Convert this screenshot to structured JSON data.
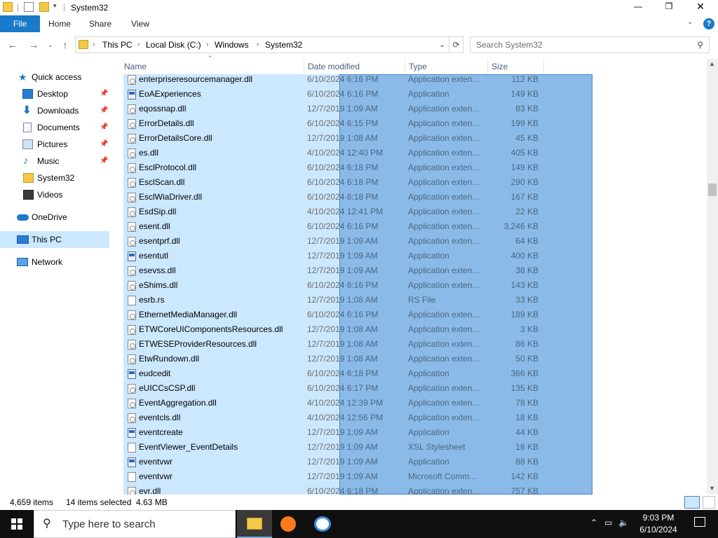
{
  "window": {
    "title": "System32"
  },
  "window_controls": {
    "minimize": "—",
    "maximize": "❐",
    "close": "✕"
  },
  "ribbon": {
    "tabs": [
      "File",
      "Home",
      "Share",
      "View"
    ],
    "help": "?"
  },
  "address": {
    "crumbs": [
      "This PC",
      "Local Disk (C:)",
      "Windows",
      "System32"
    ]
  },
  "search": {
    "placeholder": "Search System32"
  },
  "sidebar": {
    "items": [
      {
        "label": "Quick access",
        "icon": "star-icon"
      },
      {
        "label": "Desktop",
        "icon": "desktop-icon",
        "pinned": true
      },
      {
        "label": "Downloads",
        "icon": "download-icon",
        "pinned": true
      },
      {
        "label": "Documents",
        "icon": "documents-icon",
        "pinned": true
      },
      {
        "label": "Pictures",
        "icon": "pictures-icon",
        "pinned": true
      },
      {
        "label": "Music",
        "icon": "music-icon",
        "pinned": true
      },
      {
        "label": "System32",
        "icon": "folder-icon"
      },
      {
        "label": "Videos",
        "icon": "videos-icon"
      },
      {
        "label": "OneDrive",
        "icon": "cloud-icon"
      },
      {
        "label": "This PC",
        "icon": "computer-icon",
        "selected": true
      },
      {
        "label": "Network",
        "icon": "network-icon"
      }
    ]
  },
  "columns": [
    "Name",
    "Date modified",
    "Type",
    "Size"
  ],
  "files": [
    {
      "name": "enterpriseresourcemanager.dll",
      "date": "6/10/2024 6:16 PM",
      "type": "Application exten...",
      "size": "112 KB",
      "kind": "dll"
    },
    {
      "name": "EoAExperiences",
      "date": "6/10/2024 6:16 PM",
      "type": "Application",
      "size": "149 KB",
      "kind": "app"
    },
    {
      "name": "eqossnap.dll",
      "date": "12/7/2019 1:09 AM",
      "type": "Application exten...",
      "size": "83 KB",
      "kind": "dll"
    },
    {
      "name": "ErrorDetails.dll",
      "date": "6/10/2024 6:15 PM",
      "type": "Application exten...",
      "size": "199 KB",
      "kind": "dll"
    },
    {
      "name": "ErrorDetailsCore.dll",
      "date": "12/7/2019 1:08 AM",
      "type": "Application exten...",
      "size": "45 KB",
      "kind": "dll"
    },
    {
      "name": "es.dll",
      "date": "4/10/2024 12:40 PM",
      "type": "Application exten...",
      "size": "405 KB",
      "kind": "dll"
    },
    {
      "name": "EsclProtocol.dll",
      "date": "6/10/2024 6:18 PM",
      "type": "Application exten...",
      "size": "149 KB",
      "kind": "dll"
    },
    {
      "name": "EsclScan.dll",
      "date": "6/10/2024 6:18 PM",
      "type": "Application exten...",
      "size": "290 KB",
      "kind": "dll"
    },
    {
      "name": "EsclWiaDriver.dll",
      "date": "6/10/2024 6:18 PM",
      "type": "Application exten...",
      "size": "167 KB",
      "kind": "dll"
    },
    {
      "name": "EsdSip.dll",
      "date": "4/10/2024 12:41 PM",
      "type": "Application exten...",
      "size": "22 KB",
      "kind": "dll"
    },
    {
      "name": "esent.dll",
      "date": "6/10/2024 6:16 PM",
      "type": "Application exten...",
      "size": "3,246 KB",
      "kind": "dll"
    },
    {
      "name": "esentprf.dll",
      "date": "12/7/2019 1:09 AM",
      "type": "Application exten...",
      "size": "64 KB",
      "kind": "dll"
    },
    {
      "name": "esentutl",
      "date": "12/7/2019 1:09 AM",
      "type": "Application",
      "size": "400 KB",
      "kind": "app"
    },
    {
      "name": "esevss.dll",
      "date": "12/7/2019 1:09 AM",
      "type": "Application exten...",
      "size": "38 KB",
      "kind": "dll"
    },
    {
      "name": "eShims.dll",
      "date": "6/10/2024 6:16 PM",
      "type": "Application exten...",
      "size": "143 KB",
      "kind": "dll"
    },
    {
      "name": "esrb.rs",
      "date": "12/7/2019 1:08 AM",
      "type": "RS File",
      "size": "33 KB",
      "kind": "file"
    },
    {
      "name": "EthernetMediaManager.dll",
      "date": "6/10/2024 6:16 PM",
      "type": "Application exten...",
      "size": "189 KB",
      "kind": "dll"
    },
    {
      "name": "ETWCoreUIComponentsResources.dll",
      "date": "12/7/2019 1:08 AM",
      "type": "Application exten...",
      "size": "3 KB",
      "kind": "dll"
    },
    {
      "name": "ETWESEProviderResources.dll",
      "date": "12/7/2019 1:08 AM",
      "type": "Application exten...",
      "size": "86 KB",
      "kind": "dll"
    },
    {
      "name": "EtwRundown.dll",
      "date": "12/7/2019 1:08 AM",
      "type": "Application exten...",
      "size": "50 KB",
      "kind": "dll"
    },
    {
      "name": "eudcedit",
      "date": "6/10/2024 6:18 PM",
      "type": "Application",
      "size": "366 KB",
      "kind": "app"
    },
    {
      "name": "eUICCsCSP.dll",
      "date": "6/10/2024 6:17 PM",
      "type": "Application exten...",
      "size": "135 KB",
      "kind": "dll"
    },
    {
      "name": "EventAggregation.dll",
      "date": "4/10/2024 12:39 PM",
      "type": "Application exten...",
      "size": "78 KB",
      "kind": "dll"
    },
    {
      "name": "eventcls.dll",
      "date": "4/10/2024 12:56 PM",
      "type": "Application exten...",
      "size": "18 KB",
      "kind": "dll"
    },
    {
      "name": "eventcreate",
      "date": "12/7/2019 1:09 AM",
      "type": "Application",
      "size": "44 KB",
      "kind": "app"
    },
    {
      "name": "EventViewer_EventDetails",
      "date": "12/7/2019 1:09 AM",
      "type": "XSL Stylesheet",
      "size": "18 KB",
      "kind": "file"
    },
    {
      "name": "eventvwr",
      "date": "12/7/2019 1:09 AM",
      "type": "Application",
      "size": "88 KB",
      "kind": "app"
    },
    {
      "name": "eventvwr",
      "date": "12/7/2019 1:09 AM",
      "type": "Microsoft Comm...",
      "size": "142 KB",
      "kind": "file"
    },
    {
      "name": "evr.dll",
      "date": "6/10/2024 6:18 PM",
      "type": "Application exten...",
      "size": "757 KB",
      "kind": "dll"
    }
  ],
  "status": {
    "items": "4,659 items",
    "selected": "14 items selected  4.63 MB"
  },
  "taskbar": {
    "search_placeholder": "Type here to search",
    "time": "9:03 PM",
    "date": "6/10/2024"
  },
  "colors": {
    "accent": "#1979ca",
    "selection": "#cce8ff",
    "taskbar": "#101010"
  }
}
